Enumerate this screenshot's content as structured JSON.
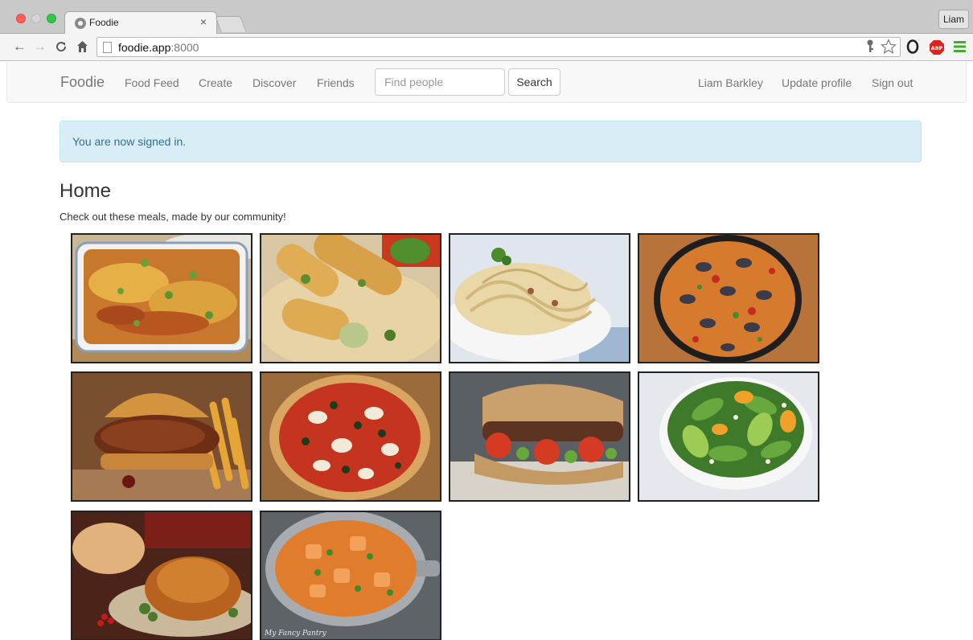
{
  "browser": {
    "tab_title": "Foodie",
    "tab_close": "×",
    "profile_name": "Liam",
    "url_host": "foodie.app",
    "url_port": ":8000"
  },
  "navbar": {
    "brand": "Foodie",
    "links": [
      "Food Feed",
      "Create",
      "Discover",
      "Friends"
    ],
    "search_placeholder": "Find people",
    "search_button": "Search",
    "user_name": "Liam Barkley",
    "update_profile": "Update profile",
    "sign_out": "Sign out"
  },
  "alert": {
    "message": "You are now signed in."
  },
  "main": {
    "title": "Home",
    "intro": "Check out these meals, made by our community!",
    "meals": [
      {
        "name": "lasagna"
      },
      {
        "name": "garlic-bread"
      },
      {
        "name": "pasta"
      },
      {
        "name": "paella"
      },
      {
        "name": "pulled-pork-burger"
      },
      {
        "name": "pizza"
      },
      {
        "name": "steak-sandwich"
      },
      {
        "name": "avocado-salad"
      },
      {
        "name": "roast-chicken"
      },
      {
        "name": "curry",
        "caption": "My Fancy Pantry"
      }
    ]
  }
}
